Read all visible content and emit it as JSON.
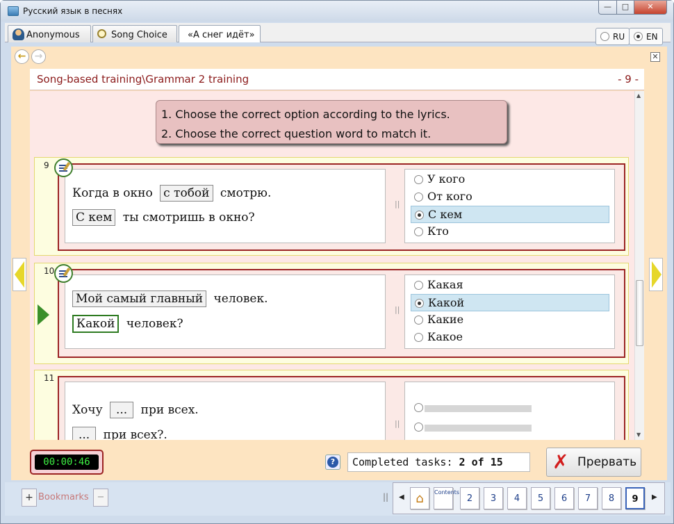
{
  "window": {
    "title": "Русский язык в песнях",
    "minimize": "—",
    "maximize": "□",
    "close": "✕"
  },
  "tabs": [
    {
      "label": "Anonymous"
    },
    {
      "label": "Song Choice"
    },
    {
      "label": "«А снег идёт»"
    }
  ],
  "languages": [
    {
      "label": "RU",
      "selected": false
    },
    {
      "label": "EN",
      "selected": true
    }
  ],
  "nav": {
    "back": "←",
    "forward": "→",
    "close": "✕"
  },
  "header": {
    "title": "Song-based training\\Grammar 2 training",
    "page": "- 9 -"
  },
  "instructions": [
    "1. Choose the correct option according to the lyrics.",
    "2. Choose the correct question word to match it."
  ],
  "tasks": [
    {
      "number": "9",
      "line1": {
        "box": "с тобой",
        "pre": "Когда в окно",
        "post": "смотрю."
      },
      "line2": {
        "box": "С кем",
        "post": "ты смотришь в окно?"
      },
      "options": [
        {
          "label": "У кого",
          "selected": false
        },
        {
          "label": "От кого",
          "selected": false
        },
        {
          "label": "С кем",
          "selected": true
        },
        {
          "label": "Кто",
          "selected": false
        }
      ]
    },
    {
      "number": "10",
      "line1": {
        "box": "Мой самый главный",
        "post": "человек."
      },
      "line2": {
        "box": "Какой",
        "post": "человек?"
      },
      "options": [
        {
          "label": "Какая",
          "selected": false
        },
        {
          "label": "Какой",
          "selected": true
        },
        {
          "label": "Какие",
          "selected": false
        },
        {
          "label": "Какое",
          "selected": false
        }
      ]
    },
    {
      "number": "11",
      "line1": {
        "pre": "Хочу",
        "box": "...",
        "post": "при всех."
      },
      "line2": {
        "box": "...",
        "post": "при всех?."
      }
    }
  ],
  "timer": "00:00:46",
  "help": "?",
  "completed": {
    "label": "Completed tasks:",
    "done": "2",
    "of": "of",
    "total": "15"
  },
  "abort": {
    "label": "Прервать"
  },
  "bookmarks": {
    "plus": "+",
    "label": "Bookmarks",
    "minus": "−"
  },
  "pager": {
    "contents_label": "Contents",
    "pages": [
      "2",
      "3",
      "4",
      "5",
      "6",
      "7",
      "8",
      "9"
    ],
    "current": "9"
  }
}
